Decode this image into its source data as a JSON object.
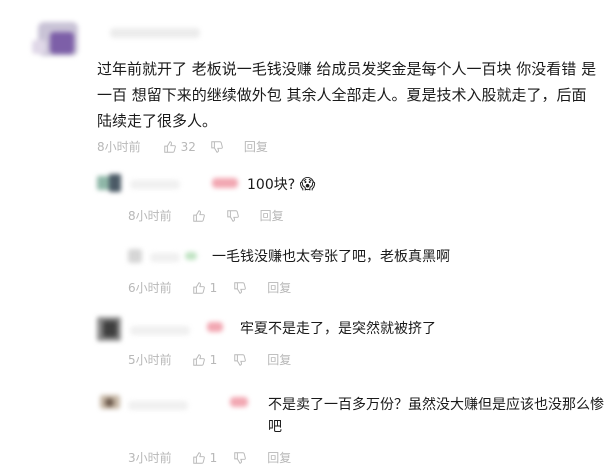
{
  "main_comment": {
    "text": "过年前就开了 老板说一毛钱没赚 给成员发奖金是每个人一百块 你没看错 是一百 想留下来的继续做外包 其余人全部走人。夏是技术入股就走了，后面陆续走了很多人。",
    "time": "8小时前",
    "likes": "32",
    "reply_label": "回复"
  },
  "replies": [
    {
      "text": "100块?",
      "emoji": "😱",
      "time": "8小时前",
      "likes": "",
      "reply_label": "回复"
    },
    {
      "text": "一毛钱没赚也太夸张了吧，老板真黑啊",
      "time": "6小时前",
      "likes": "1",
      "reply_label": "回复"
    },
    {
      "text": "牢夏不是走了，是突然就被挤了",
      "time": "5小时前",
      "likes": "1",
      "reply_label": "回复"
    },
    {
      "text": "不是卖了一百多万份？虽然没大赚但是应该也没那么惨吧",
      "time": "3小时前",
      "likes": "1",
      "reply_label": "回复"
    }
  ],
  "colors": {
    "text": "#1a1a1a",
    "meta": "#b8b8b8",
    "name_pink": "#f2a7b2",
    "name_green": "#bfe3c2"
  }
}
